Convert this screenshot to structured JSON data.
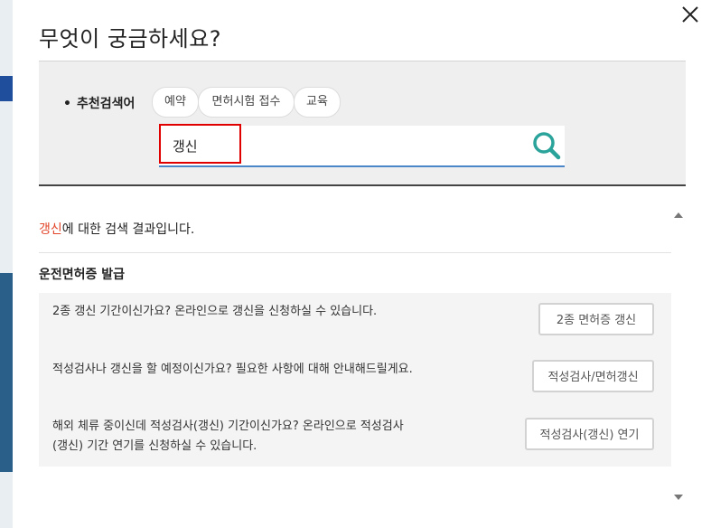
{
  "modal": {
    "title": "무엇이 궁금하세요?"
  },
  "search": {
    "recommend_label": "추천검색어",
    "chips": [
      "예약",
      "면허시험 접수",
      "교육"
    ],
    "query": "갱신"
  },
  "results": {
    "keyword": "갱신",
    "summary_suffix": "에 대한 검색 결과입니다.",
    "section_title": "운전면허증 발급",
    "items": [
      {
        "text": "2종 갱신 기간이신가요? 온라인으로 갱신을 신청하실 수 있습니다.",
        "button": "2종 면허증 갱신"
      },
      {
        "text": "적성검사나 갱신을 할 예정이신가요? 필요한 사항에 대해 안내해드릴게요.",
        "button": "적성검사/면허갱신"
      },
      {
        "text": "해외 체류 중이신데 적성검사(갱신) 기간이신가요? 온라인으로 적성검사(갱신) 기간 연기를 신청하실 수 있습니다.",
        "button": "적성검사(갱신) 연기"
      }
    ]
  },
  "colors": {
    "keyword": "#e2472b",
    "search_underline": "#4b86c8",
    "highlight": "#e00000",
    "search_icon": "#2aa39a"
  }
}
